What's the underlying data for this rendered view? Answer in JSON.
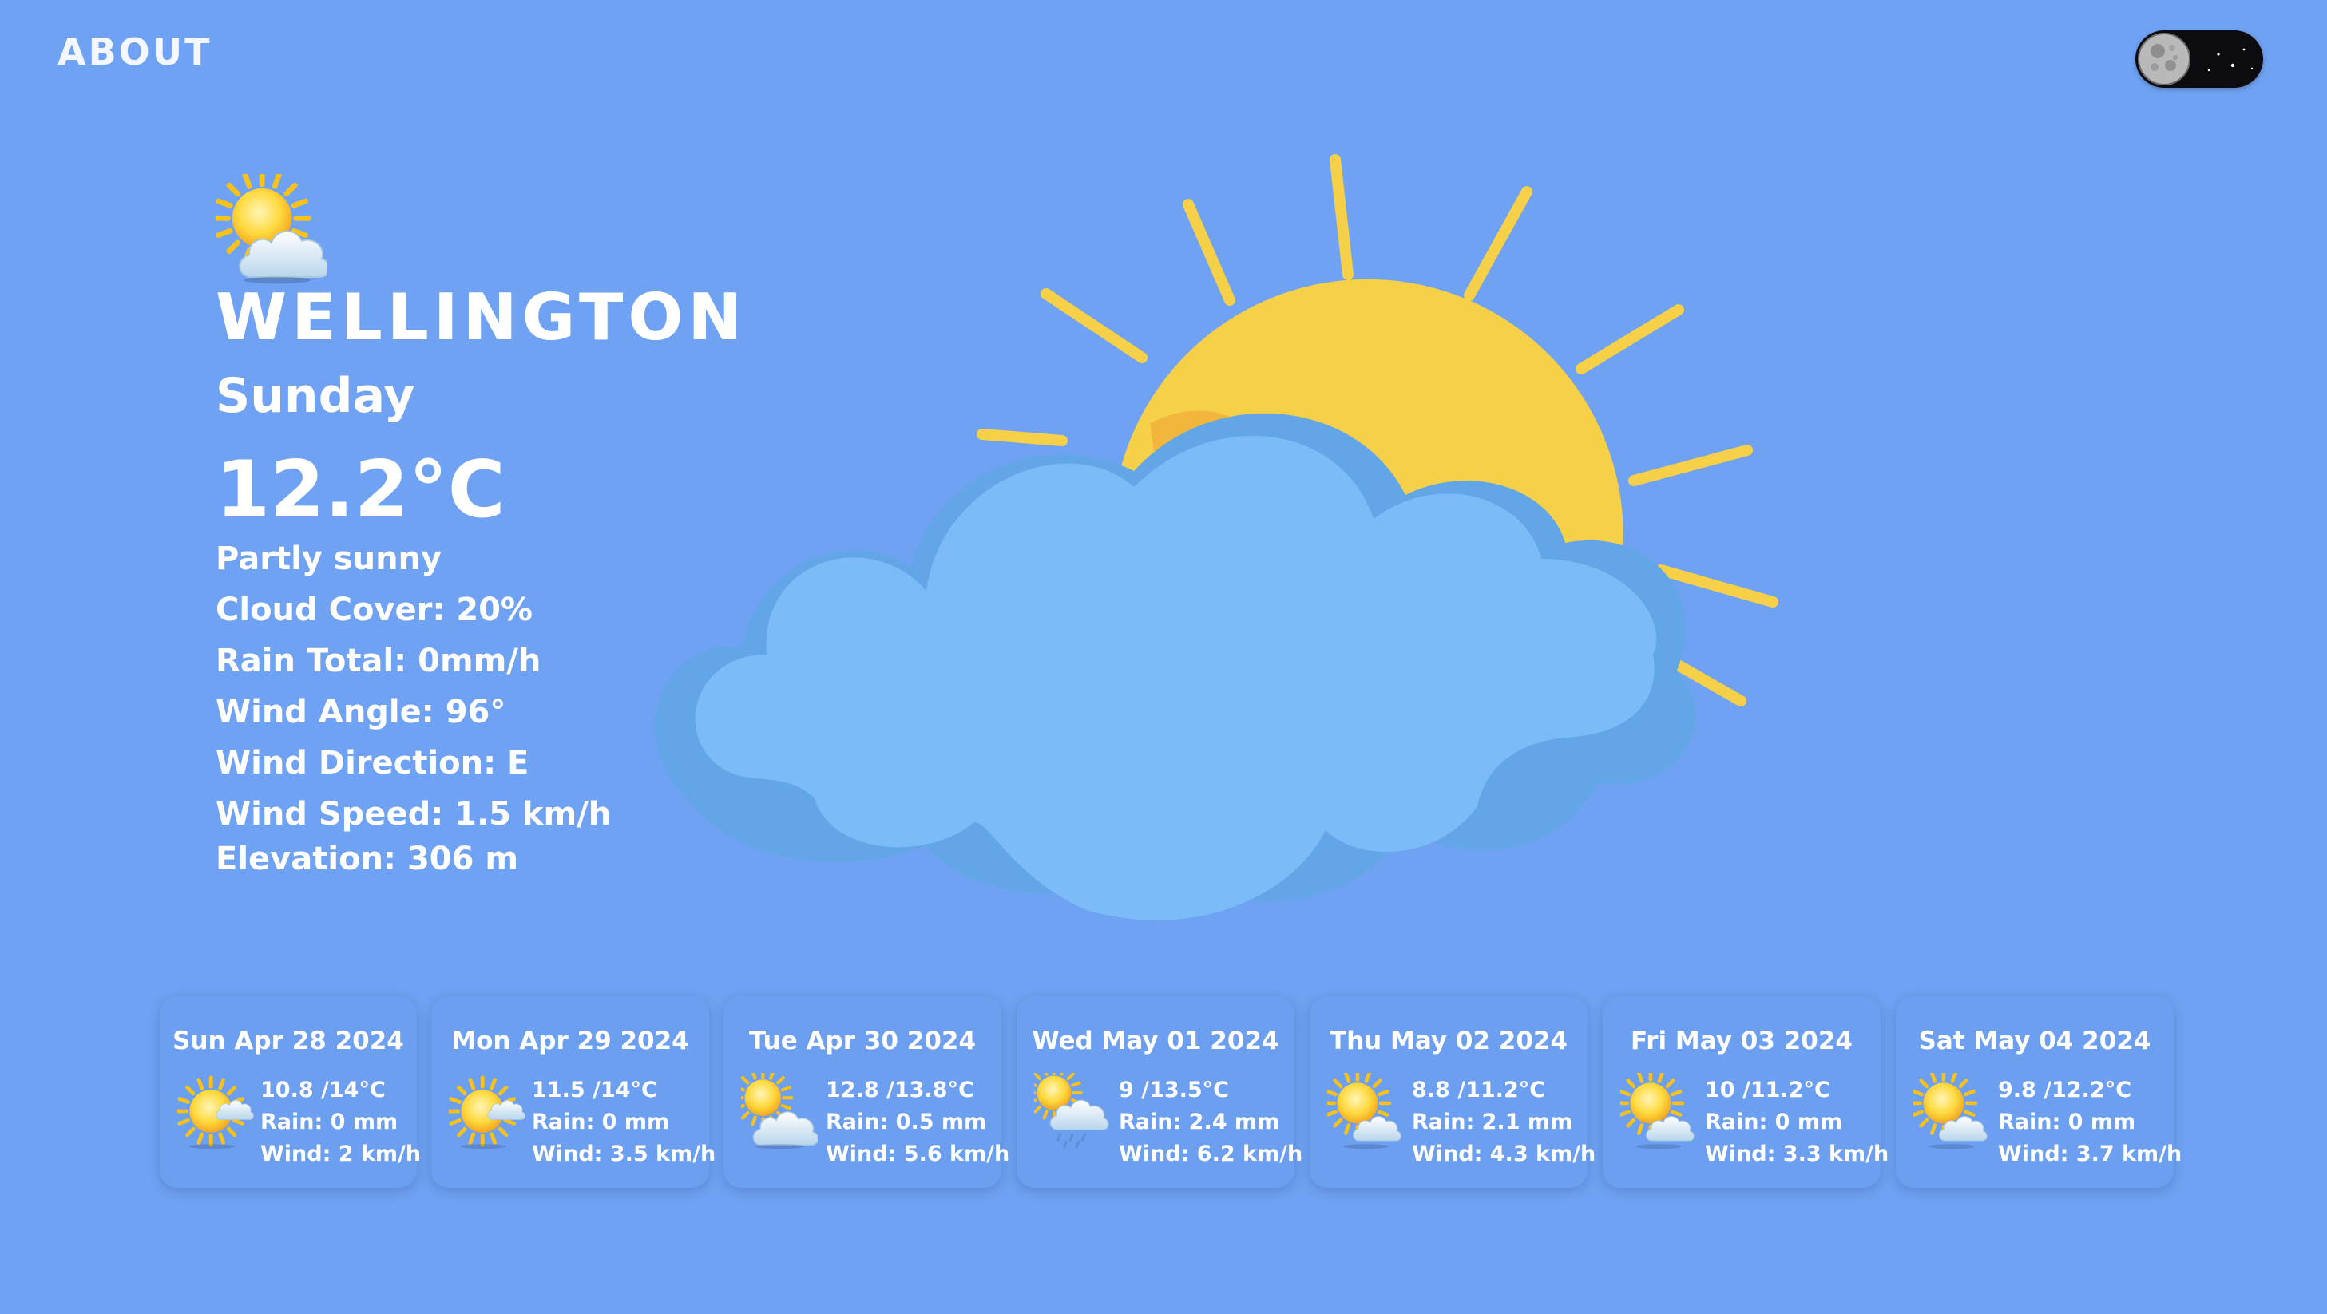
{
  "nav": {
    "about_label": "ABOUT"
  },
  "theme_toggle": {
    "icon": "moon-icon",
    "mode": "dark"
  },
  "current": {
    "icon": "partly-sunny-icon",
    "city": "WELLINGTON",
    "day": "Sunday",
    "temperature": "12.2°C",
    "condition": "Partly sunny",
    "cloud_cover": "Cloud Cover: 20%",
    "rain_total": "Rain Total: 0mm/h",
    "wind_angle": "Wind Angle: 96°",
    "wind_direction": "Wind Direction: E",
    "wind_speed": "Wind Speed: 1.5 km/h",
    "elevation": "Elevation: 306 m"
  },
  "forecast": [
    {
      "date": "Sun Apr 28 2024",
      "icon": "sun-behind-small-cloud-icon",
      "temps": "10.8 /14°C",
      "rain": "Rain: 0 mm",
      "wind": "Wind: 2 km/h"
    },
    {
      "date": "Mon Apr 29 2024",
      "icon": "sun-behind-small-cloud-icon",
      "temps": "11.5 /14°C",
      "rain": "Rain: 0 mm",
      "wind": "Wind: 3.5 km/h"
    },
    {
      "date": "Tue Apr 30 2024",
      "icon": "sun-behind-large-cloud-icon",
      "temps": "12.8 /13.8°C",
      "rain": "Rain: 0.5 mm",
      "wind": "Wind: 5.6 km/h"
    },
    {
      "date": "Wed May 01 2024",
      "icon": "sun-behind-rain-cloud-icon",
      "temps": "9 /13.5°C",
      "rain": "Rain: 2.4 mm",
      "wind": "Wind: 6.2 km/h"
    },
    {
      "date": "Thu May 02 2024",
      "icon": "sun-behind-cloud-icon",
      "temps": "8.8 /11.2°C",
      "rain": "Rain: 2.1 mm",
      "wind": "Wind: 4.3 km/h"
    },
    {
      "date": "Fri May 03 2024",
      "icon": "sun-behind-cloud-icon",
      "temps": "10 /11.2°C",
      "rain": "Rain: 0 mm",
      "wind": "Wind: 3.3 km/h"
    },
    {
      "date": "Sat May 04 2024",
      "icon": "sun-behind-cloud-icon",
      "temps": "9.8 /12.2°C",
      "rain": "Rain: 0 mm",
      "wind": "Wind: 3.7 km/h"
    }
  ],
  "colors": {
    "background": "#6fa2f2",
    "sun": "#f7d04a",
    "sun_shade": "#f3b63c",
    "cloud_light": "#7bbcf8",
    "cloud_dark": "#62a6e8"
  }
}
